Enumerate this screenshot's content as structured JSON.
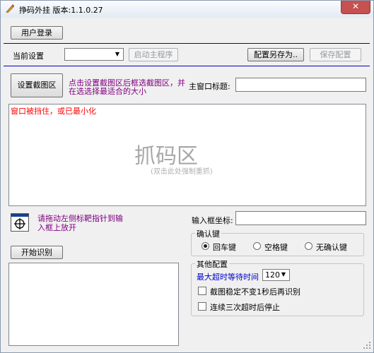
{
  "window": {
    "title": "挣码外挂 版本:1.1.0.27",
    "close_glyph": "✕"
  },
  "top": {
    "login_button": "用户登录"
  },
  "settings_row": {
    "current_label": "当前设置",
    "current_value": "",
    "launch_button": "启动主程序",
    "save_as_button": "配置另存为..",
    "save_button": "保存配置"
  },
  "capture_row": {
    "set_region_button": "设置截图区",
    "hint_line1": "点击设置截图区后框选截图区，并",
    "hint_line2": "在选选择最适合的大小",
    "main_title_label": "主窗口标题:",
    "main_title_value": ""
  },
  "preview": {
    "warning": "窗口被挡住，或已最小化",
    "big_text": "抓码区",
    "sub_text": "(双击此处强制重抓)"
  },
  "target": {
    "hint_line1": "请拖动左侧标靶指针到输",
    "hint_line2": "入框上放开",
    "coord_label": "输入框坐标:",
    "coord_value": ""
  },
  "recognize": {
    "start_button": "开始识别",
    "output_text": ""
  },
  "confirm_group": {
    "title": "确认键",
    "options": [
      "回车键",
      "空格键",
      "无确认键"
    ],
    "selected": 0
  },
  "other_group": {
    "title": "其他配置",
    "timeout_label": "最大超时等待时间",
    "timeout_value": "120",
    "check1": "截图稳定不变1秒后再识别",
    "check2": "连续三次超时后停止"
  },
  "colors": {
    "warning": "#ff0000",
    "hint": "#800080",
    "divider": "#0000c8",
    "close": "#c75050"
  }
}
